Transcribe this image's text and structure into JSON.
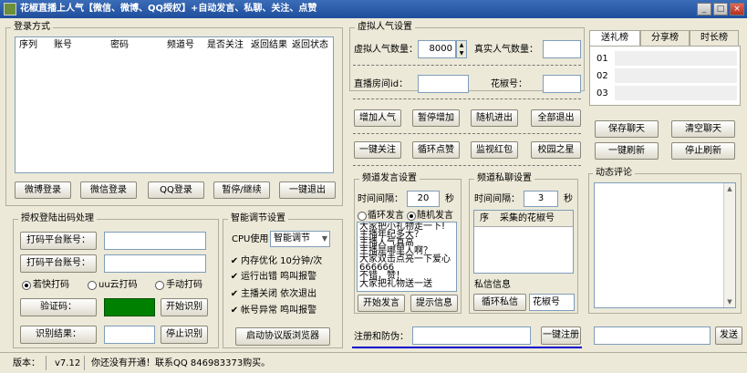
{
  "window": {
    "title": "花椒直播上人气【微信、微博、QQ授权】+自动发言、私聊、关注、点赞"
  },
  "login": {
    "legend": "登录方式",
    "columns": [
      "序列",
      "账号",
      "密码",
      "频道号",
      "是否关注",
      "返回结果",
      "返回状态"
    ],
    "buttons": [
      "微博登录",
      "微信登录",
      "QQ登录",
      "暂停/继续",
      "一键退出"
    ]
  },
  "auth": {
    "legend": "授权登陆出码处理",
    "platform_account_label_1": "打码平台账号：",
    "platform_account_label_2": "打码平台账号：",
    "radio_ruokuai": "若快打码",
    "radio_uu": "uu云打码",
    "radio_manual": "手动打码",
    "captcha_label": "验证码：",
    "start_recognize": "开始识别",
    "result_label": "识别结果：",
    "stop_recognize": "停止识别"
  },
  "smart": {
    "legend": "智能调节设置",
    "cpu_label": "CPU使用",
    "cpu_value": "智能调节",
    "opt1": "内存优化 10分钟/次",
    "opt2": "运行出错 鸣叫报警",
    "opt3": "主播关闭 依次退出",
    "opt4": "帐号异常 鸣叫报警",
    "browser_button": "启动协议版浏览器"
  },
  "virtual": {
    "legend": "虚拟人气设置",
    "count_label": "虚拟人气数量：",
    "count_value": "8000",
    "real_label": "真实人气数量：",
    "room_label": "直播房间id：",
    "huajiao_label": "花椒号：",
    "row1": [
      "增加人气",
      "暂停增加",
      "随机进出",
      "全部退出"
    ],
    "row2": [
      "一键关注",
      "循环点赞",
      "监视红包",
      "校园之星"
    ]
  },
  "speech": {
    "legend": "频道发言设置",
    "interval_label": "时间间隔：",
    "interval_value": "20",
    "unit": "秒",
    "radio_loop": "循环发言",
    "radio_random": "随机发言",
    "lines": [
      "大家把小礼物走一下!",
      "主播年纪多大？",
      "主播人气真高",
      "主播是哪里人啊？",
      "大家双击点亮一下爱心",
      "666666",
      "不错，赞！",
      "大家把礼物送一送"
    ],
    "start_button": "开始发言",
    "tip_button": "提示信息"
  },
  "private": {
    "legend": "频道私聊设置",
    "interval_label": "时间间隔：",
    "interval_value": "3",
    "unit": "秒",
    "col_index": "序",
    "col_name": "采集的花椒号",
    "msg_label": "私信信息",
    "loop_button": "循环私信",
    "huajiao_label": "花椒号"
  },
  "register": {
    "label": "注册和防伪：",
    "button": "一键注册"
  },
  "ranking": {
    "tabs": [
      "送礼榜",
      "分享榜",
      "时长榜"
    ],
    "rows": [
      "01",
      "02",
      "03"
    ],
    "buttons": [
      "保存聊天",
      "清空聊天",
      "一键刷新",
      "停止刷新"
    ],
    "dynamic_legend": "动态评论",
    "send_button": "发送"
  },
  "status": {
    "version_label": "版本：",
    "version": "v7.12",
    "message": "你还没有开通！联系QQ 846983373购买。"
  },
  "colors": {
    "titlebar": "#1f4e9c",
    "captcha_box": "#008000",
    "underline": "#0000cc"
  }
}
